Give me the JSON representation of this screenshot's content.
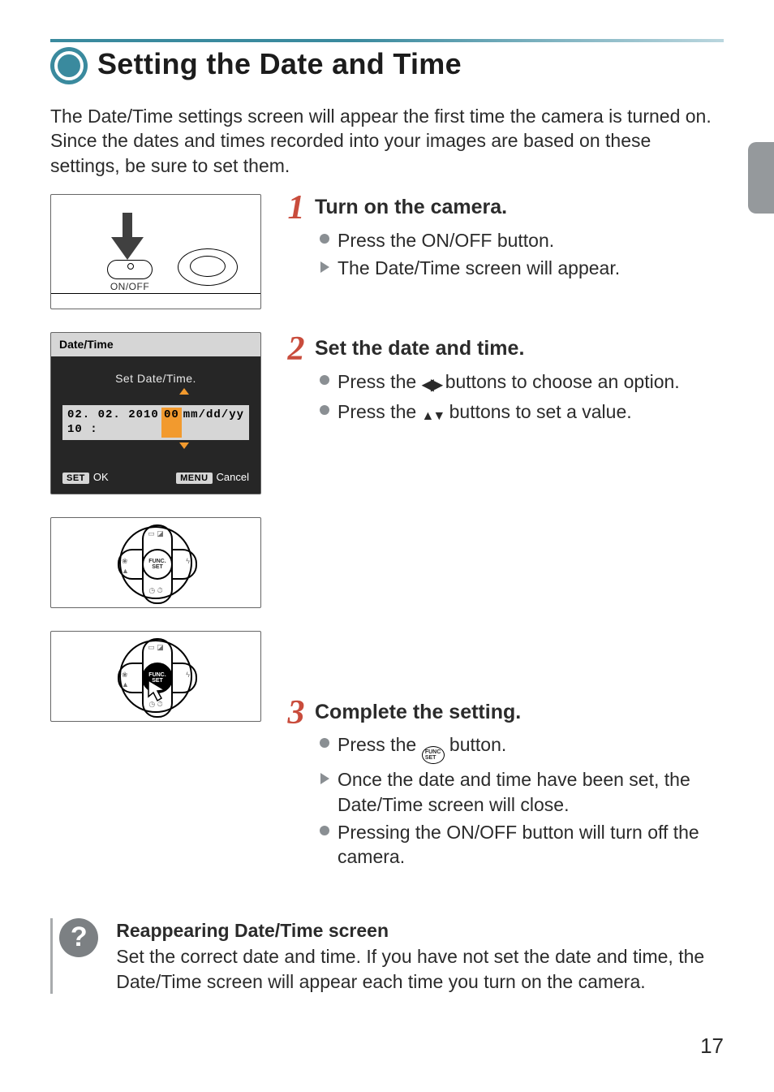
{
  "heading": "Setting the Date and Time",
  "intro": "The Date/Time settings screen will appear the first time the camera is turned on. Since the dates and times recorded into your images are based on these settings, be sure to set them.",
  "steps": [
    {
      "num": "1",
      "title": "Turn on the camera.",
      "items": [
        {
          "kind": "dot",
          "text": "Press the ON/OFF button."
        },
        {
          "kind": "tri",
          "text": "The Date/Time screen will appear."
        }
      ]
    },
    {
      "num": "2",
      "title": "Set the date and time.",
      "items": [
        {
          "kind": "dot",
          "pre": "Press the ",
          "ico": "lr",
          "post": " buttons to choose an option."
        },
        {
          "kind": "dot",
          "pre": "Press the ",
          "ico": "ud",
          "post": " buttons to set a value."
        }
      ]
    },
    {
      "num": "3",
      "title": "Complete the setting.",
      "items": [
        {
          "kind": "dot",
          "pre": "Press the ",
          "ico": "func",
          "post": " button."
        },
        {
          "kind": "tri",
          "text": "Once the date and time have been set, the Date/Time screen will close."
        },
        {
          "kind": "dot",
          "text": "Pressing the ON/OFF button will turn off the camera."
        }
      ]
    }
  ],
  "lcd": {
    "title": "Date/Time",
    "subtitle": "Set Date/Time.",
    "value_pre": "02. 02. 2010 10 :",
    "value_hl": "00",
    "value_post": " mm/dd/yy",
    "ok_tag": "SET",
    "ok_label": "OK",
    "cancel_tag": "MENU",
    "cancel_label": "Cancel"
  },
  "onoff_label": "ON/OFF",
  "funcset_label": "FUNC.\nSET",
  "tip": {
    "title": "Reappearing Date/Time screen",
    "body": "Set the correct date and time. If you have not set the date and time, the Date/Time screen will appear each time you turn on the camera."
  },
  "page_number": "17"
}
